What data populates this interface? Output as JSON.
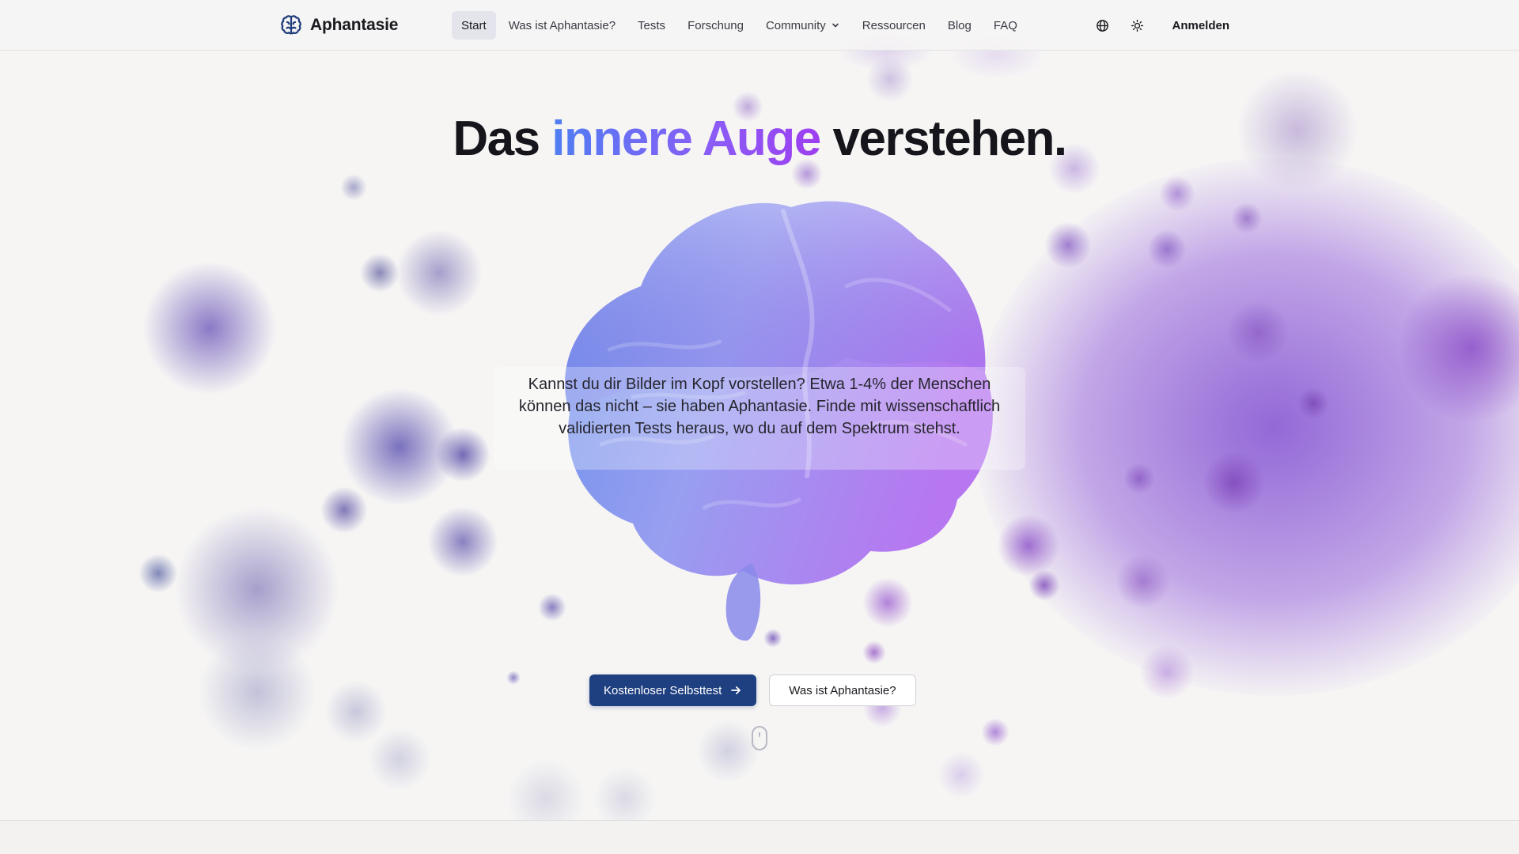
{
  "brand": {
    "name": "Aphantasie",
    "logo_icon": "brain-icon"
  },
  "nav": {
    "items": [
      {
        "label": "Start",
        "active": true
      },
      {
        "label": "Was ist Aphantasie?",
        "active": false
      },
      {
        "label": "Tests",
        "active": false
      },
      {
        "label": "Forschung",
        "active": false
      },
      {
        "label": "Community",
        "active": false,
        "has_dropdown": true
      },
      {
        "label": "Ressourcen",
        "active": false
      },
      {
        "label": "Blog",
        "active": false
      },
      {
        "label": "FAQ",
        "active": false
      }
    ]
  },
  "tools": {
    "language_icon": "globe-icon",
    "theme_icon": "sun-icon",
    "login_label": "Anmelden"
  },
  "hero": {
    "title_before": "Das ",
    "title_highlight": "innere Auge",
    "title_after": " verstehen.",
    "description": "Kannst du dir Bilder im Kopf vorstellen? Etwa 1-4% der Menschen können das nicht – sie haben Aphantasie. Finde mit wissenschaftlich validierten Tests heraus, wo du auf dem Spektrum stehst.",
    "primary_cta": "Kostenloser Selbsttest",
    "primary_cta_icon": "arrow-right-icon",
    "secondary_cta": "Was ist Aphantasie?",
    "scroll_icon": "mouse-scroll-icon"
  },
  "colors": {
    "accent_blue": "#4f7ef2",
    "accent_purple": "#9d3ef0",
    "primary_button": "#1e3f80",
    "background": "#f6f5f4"
  }
}
